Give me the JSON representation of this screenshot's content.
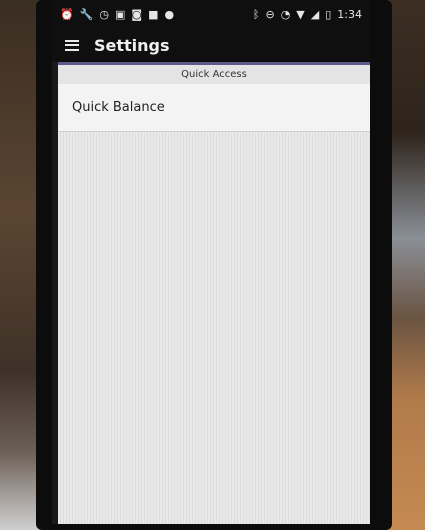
{
  "status_bar": {
    "left_icons": [
      "alarm-icon",
      "wrench-icon",
      "clock-icon",
      "lock-icon",
      "camera-icon",
      "bag-icon",
      "android-icon"
    ],
    "right_icons": [
      "bluetooth-icon",
      "do-not-disturb-icon",
      "alarm-icon",
      "wifi-icon",
      "signal-icon",
      "battery-icon"
    ],
    "time": "1:34"
  },
  "app_bar": {
    "title": "Settings",
    "menu_icon": "hamburger-menu-icon"
  },
  "settings": {
    "section_header": "Quick Access",
    "items": [
      {
        "label": "Quick Balance"
      }
    ]
  }
}
